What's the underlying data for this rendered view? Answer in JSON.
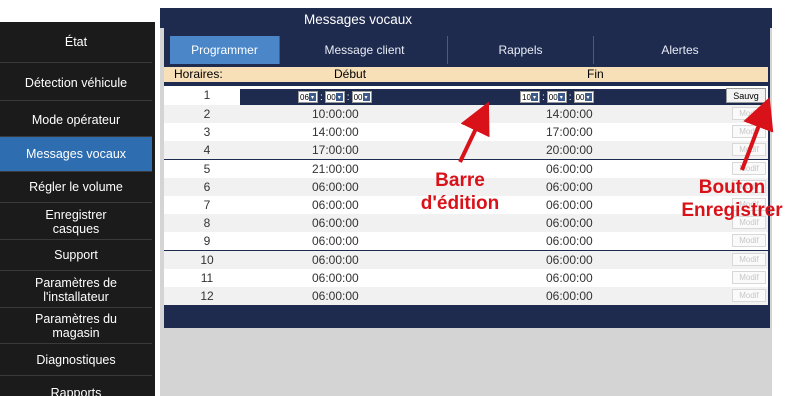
{
  "window": {
    "title": "Messages vocaux"
  },
  "sidebar": {
    "items": [
      {
        "label": "État"
      },
      {
        "label": "Détection véhicule"
      },
      {
        "label": "Mode opérateur"
      },
      {
        "label": "Messages vocaux",
        "active": true
      },
      {
        "label": "Régler le volume"
      },
      {
        "label": "Enregistrer casques"
      },
      {
        "label": "Support"
      },
      {
        "label": "Paramètres de l'installateur"
      },
      {
        "label": "Paramètres du magasin"
      },
      {
        "label": "Diagnostiques"
      },
      {
        "label": "Rapports"
      }
    ]
  },
  "tabs": [
    {
      "label": "Programmer",
      "active": true
    },
    {
      "label": "Message client"
    },
    {
      "label": "Rappels"
    },
    {
      "label": "Alertes"
    }
  ],
  "table": {
    "headers": {
      "slots": "Horaires:",
      "start": "Début",
      "end": "Fin"
    },
    "edit_row": {
      "index": "1",
      "start": {
        "h": "06",
        "m": "00",
        "s": "00"
      },
      "end": {
        "h": "10",
        "m": "00",
        "s": "00"
      },
      "save_label": "Sauvg"
    },
    "rows": [
      {
        "index": "2",
        "start": "10:00:00",
        "end": "14:00:00",
        "modify": "Modif"
      },
      {
        "index": "3",
        "start": "14:00:00",
        "end": "17:00:00",
        "modify": "Modif"
      },
      {
        "index": "4",
        "start": "17:00:00",
        "end": "20:00:00",
        "modify": "Modif"
      },
      {
        "index": "5",
        "start": "21:00:00",
        "end": "06:00:00",
        "modify": "Modif"
      },
      {
        "index": "6",
        "start": "06:00:00",
        "end": "06:00:00",
        "modify": "Modif"
      },
      {
        "index": "7",
        "start": "06:00:00",
        "end": "06:00:00",
        "modify": "Modif"
      },
      {
        "index": "8",
        "start": "06:00:00",
        "end": "06:00:00",
        "modify": "Modif"
      },
      {
        "index": "9",
        "start": "06:00:00",
        "end": "06:00:00",
        "modify": "Modif"
      },
      {
        "index": "10",
        "start": "06:00:00",
        "end": "06:00:00",
        "modify": "Modif"
      },
      {
        "index": "11",
        "start": "06:00:00",
        "end": "06:00:00",
        "modify": "Modif"
      },
      {
        "index": "12",
        "start": "06:00:00",
        "end": "06:00:00",
        "modify": "Modif"
      }
    ]
  },
  "annotations": {
    "edit_bar": "Barre d'édition",
    "save_button": "Bouton Enregistrer"
  },
  "colors": {
    "accent": "#4a86c8",
    "panel": "#1e2b4f",
    "header_row": "#f7dfb8",
    "annotation": "#d9121a",
    "sidebar": "#1b1b1b"
  }
}
